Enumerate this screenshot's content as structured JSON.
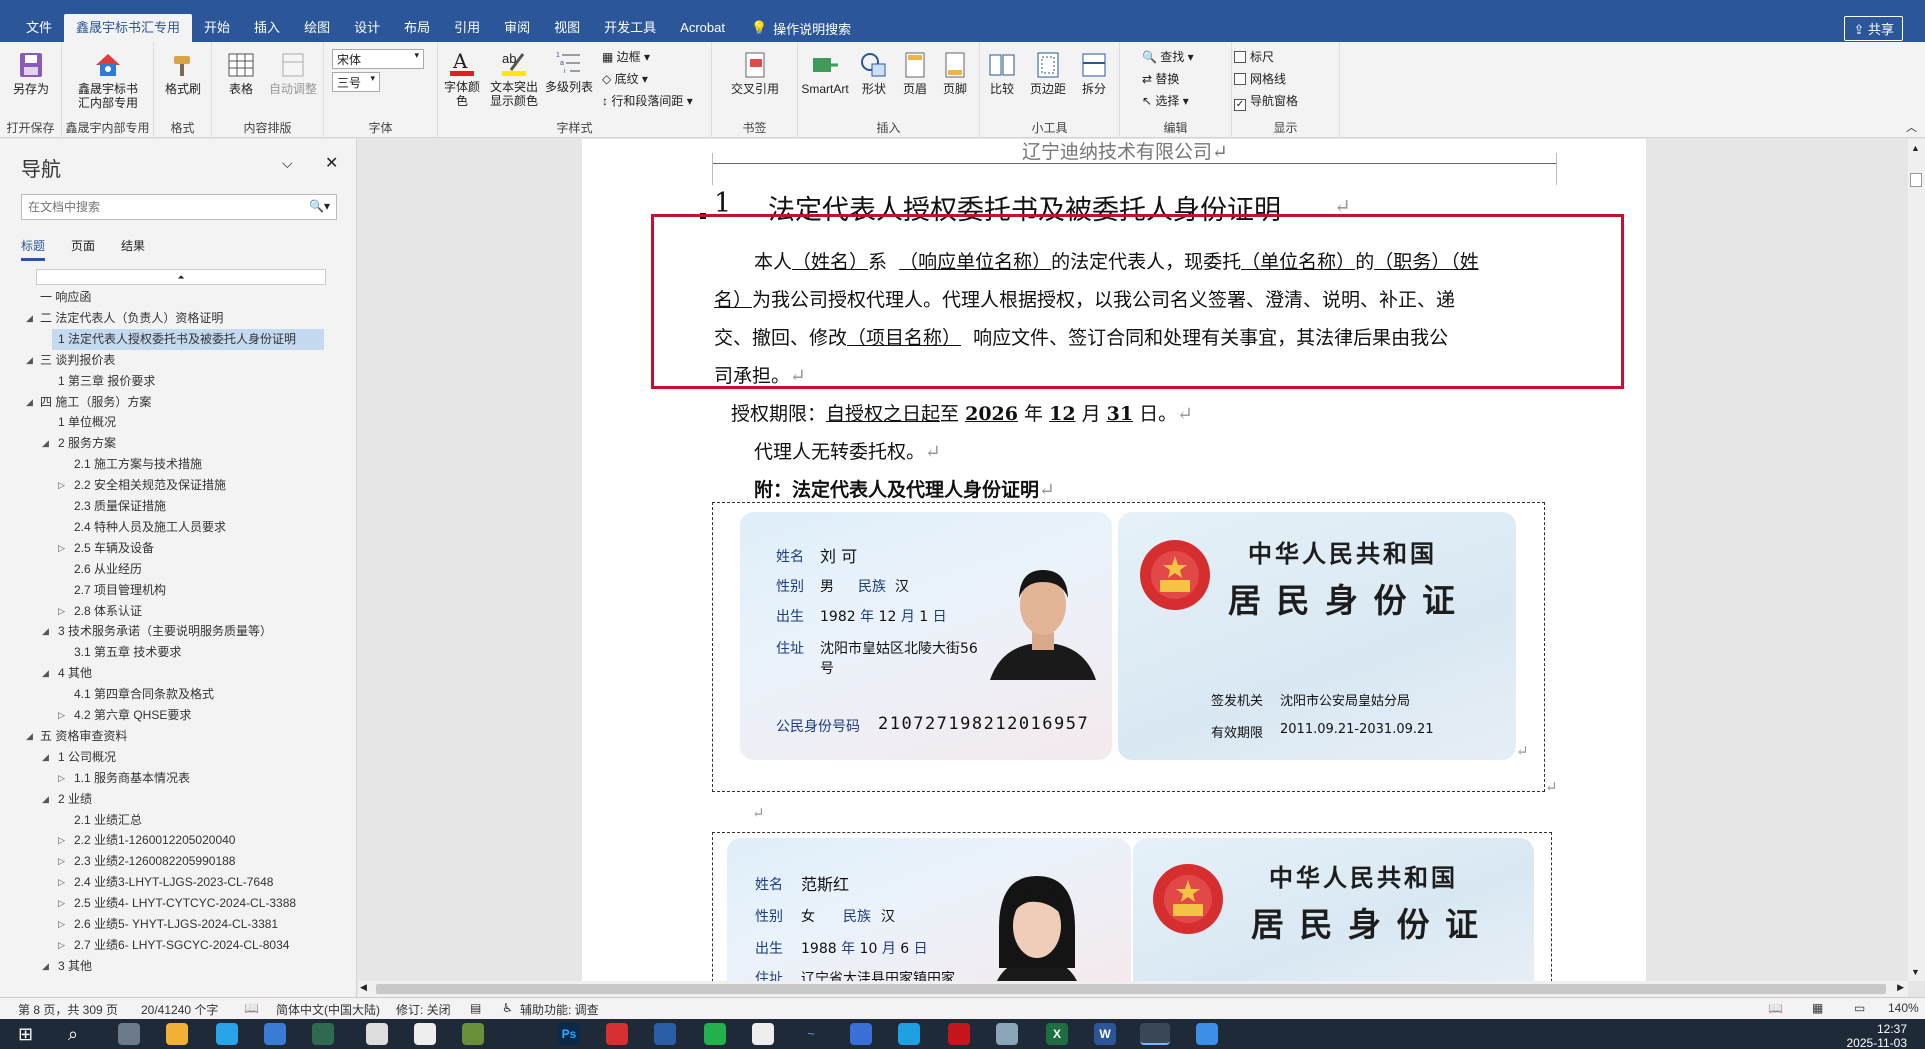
{
  "window": {
    "share_label": "共享"
  },
  "tabs": [
    "文件",
    "鑫晟宇标书汇专用",
    "开始",
    "插入",
    "绘图",
    "设计",
    "布局",
    "引用",
    "审阅",
    "视图",
    "开发工具",
    "Acrobat"
  ],
  "tellme": "操作说明搜索",
  "ribbon": {
    "save_as": "另存为",
    "open_save": "打开保存",
    "xsy_btn": "鑫晟宇标书汇内部专用",
    "xsy_group": "鑫晟宇内部专用",
    "format_painter": "格式刷",
    "format_group": "格式",
    "table": "表格",
    "autofit": "自动调整",
    "content_group": "内容排版",
    "font_name": "宋体",
    "font_size": "三号",
    "font_group": "字体",
    "font_color": "字体颜色",
    "highlight": "文本突出显示颜色",
    "multilevel": "多级列表",
    "border": "边框",
    "shading": "底纹",
    "line_spacing": "行和段落间距",
    "paragraph_group": "字样式",
    "cross_ref": "交叉引用",
    "bookmark_group": "书签",
    "smartart": "SmartArt",
    "shapes": "形状",
    "header": "页眉",
    "footer": "页脚",
    "insert_group": "插入",
    "compare": "比较",
    "margins": "页边距",
    "split": "拆分",
    "tools_group": "小工具",
    "find": "查找",
    "replace": "替换",
    "select": "选择",
    "edit_group": "编辑",
    "ruler": "标尺",
    "gridlines": "网格线",
    "nav_pane": "导航窗格",
    "show_group": "显示"
  },
  "nav": {
    "title": "导航",
    "search_placeholder": "在文档中搜索",
    "tabs": [
      "标题",
      "页面",
      "结果"
    ],
    "items": [
      {
        "text": "一 响应函",
        "level": 1,
        "caret": ""
      },
      {
        "text": "二 法定代表人（负责人）资格证明",
        "level": 1,
        "caret": "◢"
      },
      {
        "text": "1 法定代表人授权委托书及被委托人身份证明",
        "level": 2,
        "caret": "",
        "selected": true
      },
      {
        "text": "三 谈判报价表",
        "level": 1,
        "caret": "◢"
      },
      {
        "text": "1 第三章 报价要求",
        "level": 2,
        "caret": ""
      },
      {
        "text": "四 施工（服务）方案",
        "level": 1,
        "caret": "◢"
      },
      {
        "text": "1 单位概况",
        "level": 2,
        "caret": ""
      },
      {
        "text": "2 服务方案",
        "level": 2,
        "caret": "◢"
      },
      {
        "text": "2.1 施工方案与技术措施",
        "level": 3,
        "caret": ""
      },
      {
        "text": "2.2 安全相关规范及保证措施",
        "level": 3,
        "caret": "▷"
      },
      {
        "text": "2.3 质量保证措施",
        "level": 3,
        "caret": ""
      },
      {
        "text": "2.4 特种人员及施工人员要求",
        "level": 3,
        "caret": ""
      },
      {
        "text": "2.5 车辆及设备",
        "level": 3,
        "caret": "▷"
      },
      {
        "text": "2.6 从业经历",
        "level": 3,
        "caret": ""
      },
      {
        "text": "2.7 项目管理机构",
        "level": 3,
        "caret": ""
      },
      {
        "text": "2.8 体系认证",
        "level": 3,
        "caret": "▷"
      },
      {
        "text": "3 技术服务承诺（主要说明服务质量等）",
        "level": 2,
        "caret": "◢"
      },
      {
        "text": "3.1 第五章 技术要求",
        "level": 3,
        "caret": ""
      },
      {
        "text": "4 其他",
        "level": 2,
        "caret": "◢"
      },
      {
        "text": "4.1 第四章合同条款及格式",
        "level": 3,
        "caret": ""
      },
      {
        "text": "4.2 第六章 QHSE要求",
        "level": 3,
        "caret": "▷"
      },
      {
        "text": "五 资格审查资料",
        "level": 1,
        "caret": "◢"
      },
      {
        "text": "1 公司概况",
        "level": 2,
        "caret": "◢"
      },
      {
        "text": "1.1 服务商基本情况表",
        "level": 3,
        "caret": "▷"
      },
      {
        "text": "2 业绩",
        "level": 2,
        "caret": "◢"
      },
      {
        "text": "2.1 业绩汇总",
        "level": 3,
        "caret": ""
      },
      {
        "text": "2.2 业绩1-1260012205020040",
        "level": 3,
        "caret": "▷"
      },
      {
        "text": "2.3 业绩2-1260082205990188",
        "level": 3,
        "caret": "▷"
      },
      {
        "text": "2.4 业绩3-LHYT-LJGS-2023-CL-7648",
        "level": 3,
        "caret": "▷"
      },
      {
        "text": "2.5 业绩4- LHYT-CYTCYC-2024-CL-3388",
        "level": 3,
        "caret": "▷"
      },
      {
        "text": "2.6 业绩5- YHYT-LJGS-2024-CL-3381",
        "level": 3,
        "caret": "▷"
      },
      {
        "text": "2.7 业绩6- LHYT-SGCYC-2024-CL-8034",
        "level": 3,
        "caret": "▷"
      },
      {
        "text": "3 其他",
        "level": 2,
        "caret": "◢"
      }
    ]
  },
  "doc": {
    "header_text": "辽宁迪纳技术有限公司↵",
    "heading_num": "1",
    "heading_text": "法定代表人授权委托书及被委托人身份证明",
    "p1_a": "本人",
    "p1_b": "（姓名）",
    "p1_c": "系",
    "p1_d": "（响应单位名称）",
    "p1_e": "的法定代表人，现委托",
    "p1_f": "（单位名称）",
    "p1_g": "的",
    "p1_h": "（职务）（姓",
    "p2_a": "名）",
    "p2_b": "为我公司授权代理人。代理人根据授权，以我公司名义签署、澄清、说明、补正、递",
    "p3_a": "交、撤回、修改",
    "p3_b": "（项目名称）",
    "p3_c": "响应文件、签订合同和处理有关事宜，其法律后果由我公",
    "p4": "司承担。",
    "term_a": "授权期限：",
    "term_b": "自授权之日起",
    "term_c": "至",
    "term_year": "2026",
    "term_d": "年",
    "term_month": "12",
    "term_e": "月",
    "term_day": "31",
    "term_f": "日。",
    "no_transfer": "代理人无转委托权。",
    "attach": "附：法定代表人及代理人身份证明"
  },
  "id1": {
    "name_label": "姓名",
    "name": "刘 可",
    "sex_label": "性别",
    "sex": "男",
    "nation_label": "民族",
    "nation": "汉",
    "birth_label": "出生",
    "birth_y": "1982",
    "y": "年",
    "birth_m": "12",
    "m": "月",
    "birth_d": "1",
    "d": "日",
    "addr_label": "住址",
    "addr1": "沈阳市皇姑区北陵大街56",
    "addr2": "号",
    "idno_label": "公民身份号码",
    "idno": "210727198212016957",
    "country": "中华人民共和国",
    "title": "居 民 身 份 证",
    "issuer_label": "签发机关",
    "issuer": "沈阳市公安局皇姑分局",
    "valid_label": "有效期限",
    "valid": "2011.09.21-2031.09.21"
  },
  "id2": {
    "name_label": "姓名",
    "name": "范斯红",
    "sex_label": "性别",
    "sex": "女",
    "nation_label": "民族",
    "nation": "汉",
    "birth_label": "出生",
    "birth_y": "1988",
    "y": "年",
    "birth_m": "10",
    "m": "月",
    "birth_d": "6",
    "d": "日",
    "addr_label": "住址",
    "addr1": "辽宁省大洼县田家镇田家",
    "country": "中华人民共和国",
    "title": "居 民 身 份 证"
  },
  "status": {
    "page": "第 8 页，共 309 页",
    "words": "20/41240 个字",
    "lang": "简体中文(中国大陆)",
    "track": "修订: 关闭",
    "access": "辅助功能: 调查",
    "zoom": "140%"
  },
  "clock": {
    "time": "12:37",
    "date": "2025-11-03"
  },
  "colors": {
    "accent": "#2b579a",
    "red_box": "#c8102e"
  }
}
